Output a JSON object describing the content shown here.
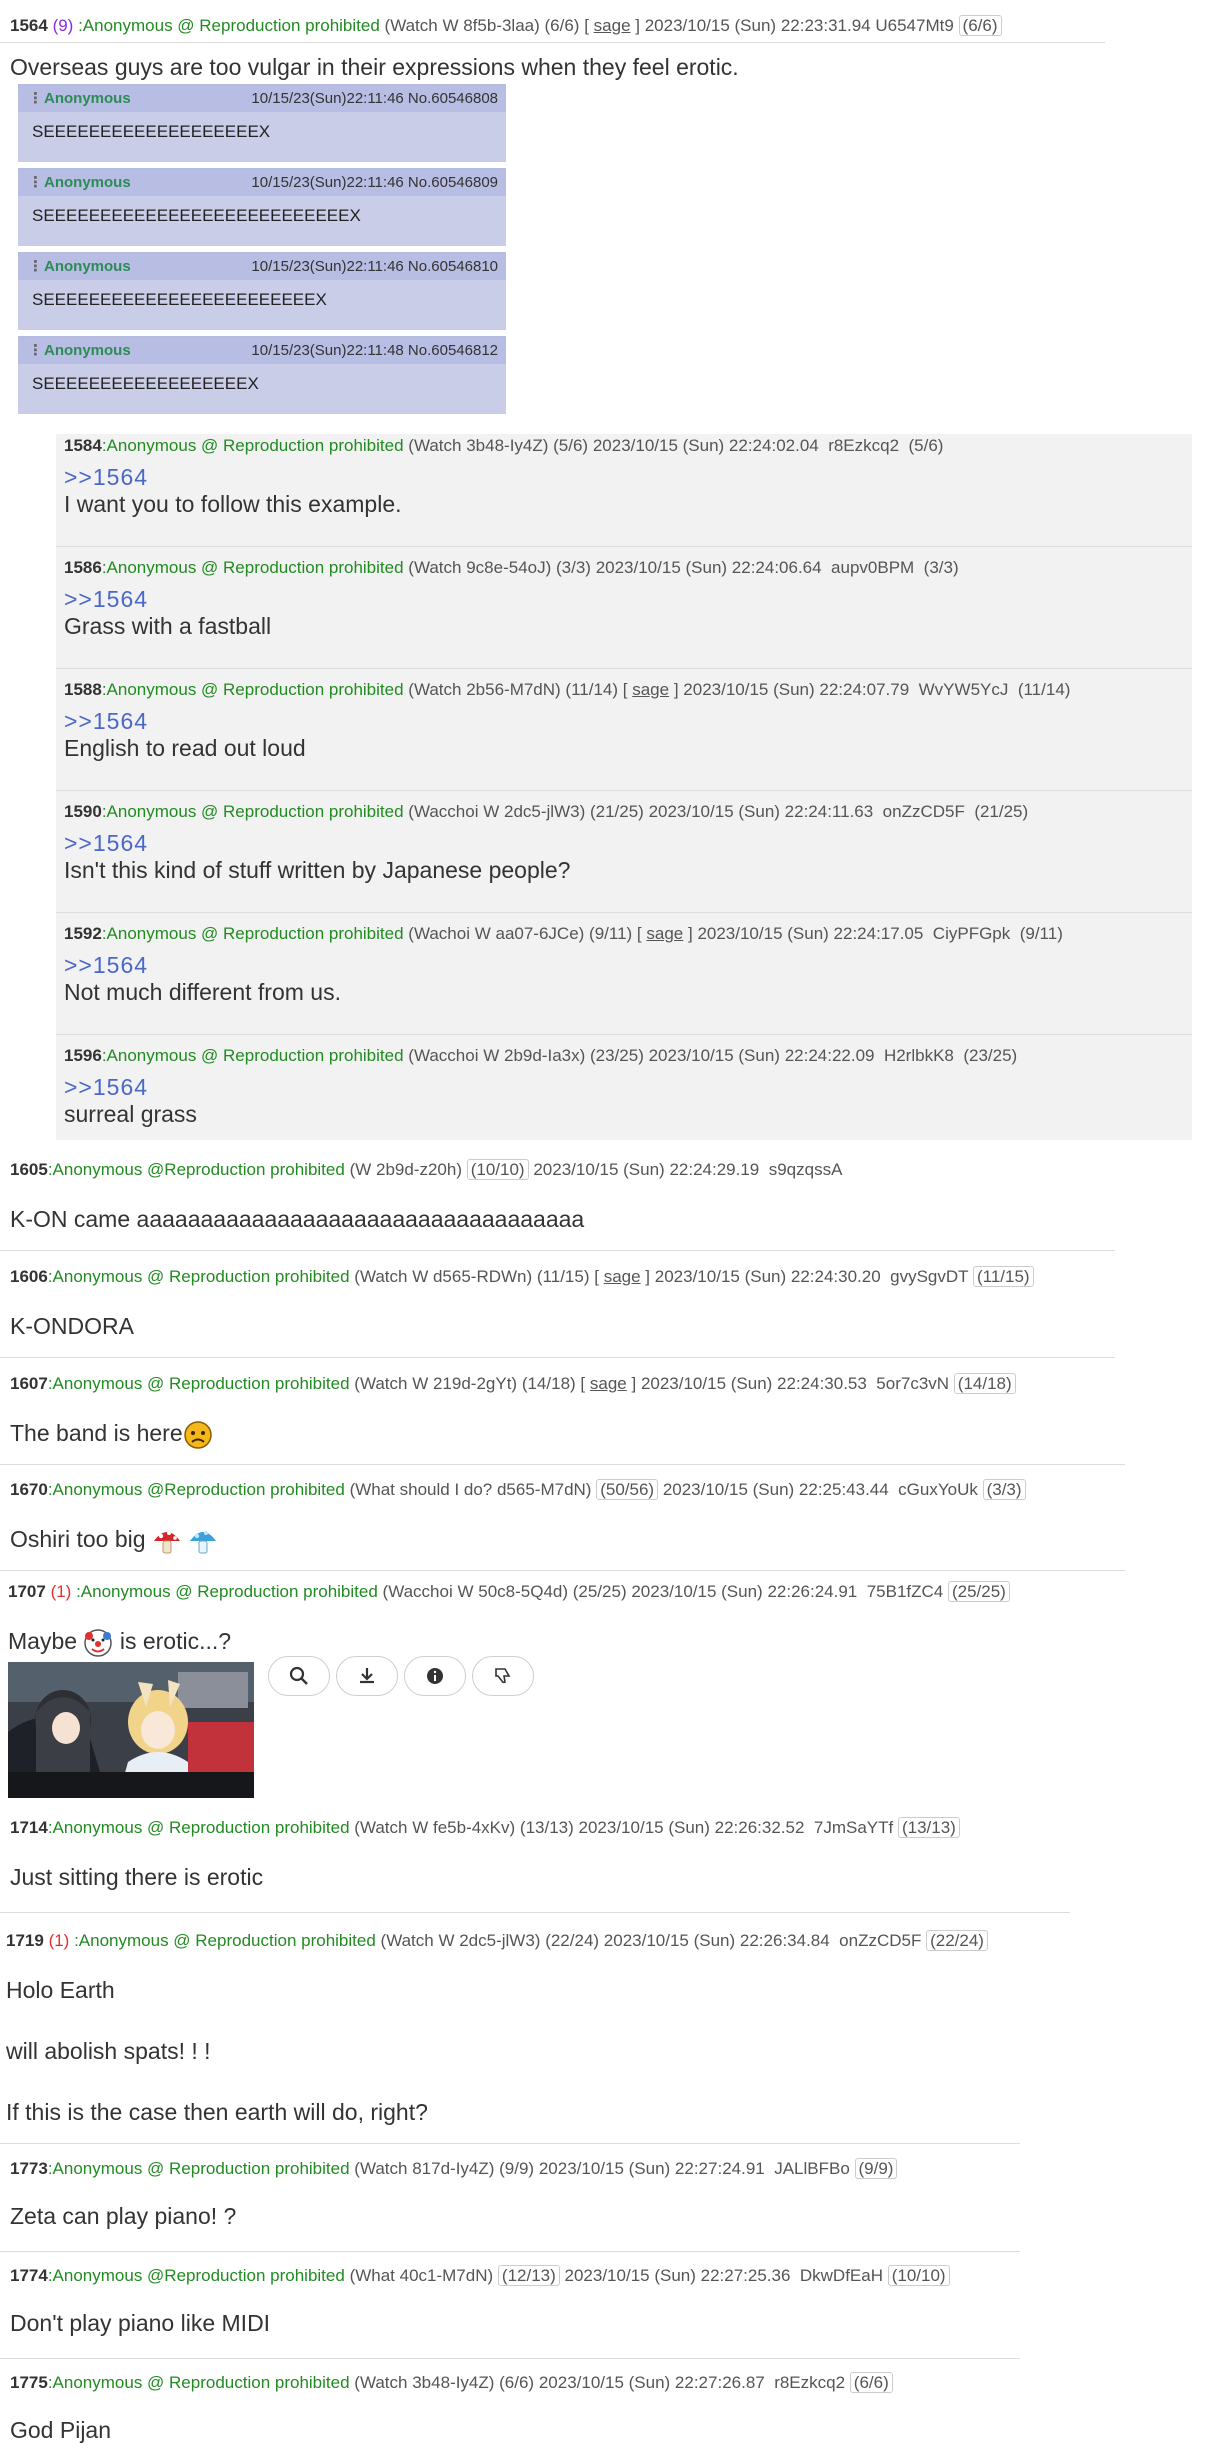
{
  "p1564": {
    "num": "1564",
    "rc": "(9)",
    "name": ":Anonymous @ Reproduction prohibited",
    "watch": "(Watch W 8f5b-3laa) (6/6)",
    "sage": "sage",
    "date": "2023/10/15 (Sun) 22:23:31.94",
    "id": "U6547Mt9",
    "cnt": "(6/6)",
    "body": "Overseas guys are too vulgar in their expressions when they feel erotic.",
    "embeds": [
      {
        "dots": "⋮",
        "name": "Anonymous",
        "meta": "10/15/23(Sun)22:11:46 No.60546808",
        "text": "SEEEEEEEEEEEEEEEEEEEX"
      },
      {
        "dots": "⋮",
        "name": "Anonymous",
        "meta": "10/15/23(Sun)22:11:46 No.60546809",
        "text": "SEEEEEEEEEEEEEEEEEEEEEEEEEEEX"
      },
      {
        "dots": "⋮",
        "name": "Anonymous",
        "meta": "10/15/23(Sun)22:11:46 No.60546810",
        "text": "SEEEEEEEEEEEEEEEEEEEEEEEEX"
      },
      {
        "dots": "⋮",
        "name": "Anonymous",
        "meta": "10/15/23(Sun)22:11:48 No.60546812",
        "text": "SEEEEEEEEEEEEEEEEEEX"
      }
    ]
  },
  "replies": [
    {
      "num": "1584",
      "name": ":Anonymous @ Reproduction prohibited",
      "watch": "(Watch 3b48-Iy4Z) (5/6)",
      "sage": "",
      "date": "2023/10/15 (Sun) 22:24:02.04",
      "id": "r8Ezkcq2",
      "cnt": "(5/6)",
      "quote": ">>1564",
      "body": "I want you to follow this example."
    },
    {
      "num": "1586",
      "name": ":Anonymous @ Reproduction prohibited",
      "watch": "(Watch 9c8e-54oJ) (3/3)",
      "sage": "",
      "date": "2023/10/15 (Sun) 22:24:06.64",
      "id": "aupv0BPM",
      "cnt": "(3/3)",
      "quote": ">>1564",
      "body": "Grass with a fastball"
    },
    {
      "num": "1588",
      "name": ":Anonymous @ Reproduction prohibited",
      "watch": "(Watch 2b56-M7dN) (11/14)",
      "sage": "sage",
      "date": "2023/10/15 (Sun) 22:24:07.79",
      "id": "WvYW5YcJ",
      "cnt": "(11/14)",
      "quote": ">>1564",
      "body": "English to read out loud"
    },
    {
      "num": "1590",
      "name": ":Anonymous @ Reproduction prohibited",
      "watch": "(Wacchoi W 2dc5-jlW3) (21/25)",
      "sage": "",
      "date": "2023/10/15 (Sun) 22:24:11.63",
      "id": "onZzCD5F",
      "cnt": "(21/25)",
      "quote": ">>1564",
      "body": "Isn't this kind of stuff written by Japanese people?"
    },
    {
      "num": "1592",
      "name": ":Anonymous @ Reproduction prohibited",
      "watch": "(Wachoi W aa07-6JCe) (9/11)",
      "sage": "sage",
      "date": "2023/10/15 (Sun) 22:24:17.05",
      "id": "CiyPFGpk",
      "cnt": "(9/11)",
      "quote": ">>1564",
      "body": "Not much different from us."
    },
    {
      "num": "1596",
      "name": ":Anonymous @ Reproduction prohibited",
      "watch": "(Wacchoi W 2b9d-Ia3x) (23/25)",
      "sage": "",
      "date": "2023/10/15 (Sun) 22:24:22.09",
      "id": "H2rlbkK8",
      "cnt": "(23/25)",
      "quote": ">>1564",
      "body": "surreal grass"
    }
  ],
  "p1605": {
    "num": "1605",
    "name": ":Anonymous @Reproduction prohibited",
    "watch": "(W 2b9d-z20h)",
    "cnt1": "(10/10)",
    "date": "2023/10/15 (Sun) 22:24:29.19",
    "id": "s9qzqssA",
    "body": "K-ON came aaaaaaaaaaaaaaaaaaaaaaaaaaaaaaaaaaa"
  },
  "p1606": {
    "num": "1606",
    "name": ":Anonymous @ Reproduction prohibited",
    "watch": "(Watch W d565-RDWn) (11/15)",
    "sage": "sage",
    "date": "2023/10/15 (Sun) 22:24:30.20",
    "id": "gvySgvDT",
    "cnt": "(11/15)",
    "body": "K-ONDORA"
  },
  "p1607": {
    "num": "1607",
    "name": ":Anonymous @ Reproduction prohibited",
    "watch": "(Watch W 219d-2gYt) (14/18)",
    "sage": "sage",
    "date": "2023/10/15 (Sun) 22:24:30.53",
    "id": "5or7c3vN",
    "cnt": "(14/18)",
    "body": "The band is here",
    "emoji": "worried-face-emoji"
  },
  "p1670": {
    "num": "1670",
    "name": ":Anonymous @Reproduction prohibited",
    "watch": "(What should I do? d565-M7dN)",
    "cnt1": "(50/56)",
    "date": "2023/10/15 (Sun) 22:25:43.44",
    "id": "cGuxYoUk",
    "cnt": "(3/3)",
    "body": "Oshiri too big",
    "emoji1": "mushroom-emoji",
    "emoji2": "blue-mushroom-emoji"
  },
  "p1707": {
    "num": "1707",
    "rc": "(1)",
    "name": ":Anonymous @ Reproduction prohibited",
    "watch": "(Wacchoi W 50c8-5Q4d) (25/25)",
    "date": "2023/10/15 (Sun) 22:26:24.91",
    "id": "75B1fZC4",
    "cnt": "(25/25)",
    "body_a": "Maybe",
    "body_b": "is erotic...?",
    "emoji": "clown-face-emoji",
    "tools": [
      "search-icon",
      "download-icon",
      "info-icon",
      "dislike-icon"
    ]
  },
  "p1714": {
    "num": "1714",
    "name": ":Anonymous @ Reproduction prohibited",
    "watch": "(Watch W fe5b-4xKv) (13/13)",
    "date": "2023/10/15 (Sun) 22:26:32.52",
    "id": "7JmSaYTf",
    "cnt": "(13/13)",
    "body": "Just sitting there is erotic"
  },
  "p1719": {
    "num": "1719",
    "rc": "(1)",
    "name": ":Anonymous @ Reproduction prohibited",
    "watch": "(Watch W 2dc5-jlW3) (22/24)",
    "date": "2023/10/15 (Sun) 22:26:34.84",
    "id": "onZzCD5F",
    "cnt": "(22/24)",
    "line1": "Holo Earth",
    "line2": "will abolish spats! ! !",
    "line3": "If this is the case then earth will do, right?"
  },
  "p1773": {
    "num": "1773",
    "name": ":Anonymous @ Reproduction prohibited",
    "watch": "(Watch 817d-Iy4Z) (9/9)",
    "date": "2023/10/15 (Sun) 22:27:24.91",
    "id": "JALlBFBo",
    "cnt": "(9/9)",
    "body": "Zeta can play piano! ?"
  },
  "p1774": {
    "num": "1774",
    "name": ":Anonymous @Reproduction prohibited",
    "watch": "(What 40c1-M7dN)",
    "cnt1": "(12/13)",
    "date": "2023/10/15 (Sun) 22:27:25.36",
    "id": "DkwDfEaH",
    "cnt": "(10/10)",
    "body": "Don't play piano like MIDI"
  },
  "p1775": {
    "num": "1775",
    "name": ":Anonymous @ Reproduction prohibited",
    "watch": "(Watch 3b48-Iy4Z) (6/6)",
    "date": "2023/10/15 (Sun) 22:27:26.87",
    "id": "r8Ezkcq2",
    "cnt": "(6/6)",
    "body": "God Pijan"
  }
}
